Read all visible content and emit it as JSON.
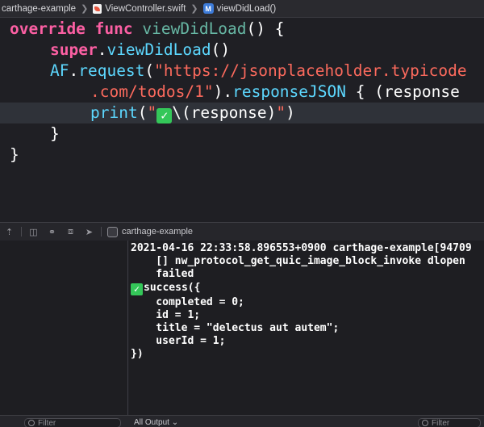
{
  "jumpbar": {
    "crumbs": [
      "carthage-example",
      "ViewController.swift",
      "viewDidLoad()"
    ]
  },
  "editor": {
    "lines": [
      {
        "t1": "override",
        "t2": "func",
        "t3": "viewDidLoad",
        "t4": "() {"
      },
      {
        "t1": "super",
        "t2": ".",
        "t3": "viewDidLoad",
        "t4": "()"
      },
      {
        "t1": "AF",
        "t2": ".",
        "t3": "request",
        "t4": "(",
        "t5": "\"https://jsonplaceholder.typicode"
      },
      {
        "t1": ".com/todos/1\"",
        "t2": ").",
        "t3": "responseJSON",
        "t4": " { (response"
      },
      {
        "t1": "print",
        "t2": "(",
        "t3": "\"",
        "t4": "\\(response)",
        "t5": "\"",
        "t6": ")"
      },
      {
        "t1": "}"
      },
      {
        "t1": "}"
      }
    ],
    "check_glyph": "✓"
  },
  "debug": {
    "target": "carthage-example"
  },
  "console": {
    "lines": [
      "2021-04-16 22:33:58.896553+0900 carthage-example[94709",
      "    [] nw_protocol_get_quic_image_block_invoke dlopen",
      "    failed",
      "success({",
      "    completed = 0;",
      "    id = 1;",
      "    title = \"delectus aut autem\";",
      "    userId = 1;",
      "})"
    ]
  },
  "footer": {
    "left_filter": "Filter",
    "output": "All Output",
    "right_filter": "Filter"
  },
  "colors": {
    "keyword": "#fc5fa3",
    "function": "#67b7a4",
    "type": "#5dd8ff",
    "string": "#fc6a5d",
    "check": "#34c759",
    "background": "#1f1f24"
  }
}
